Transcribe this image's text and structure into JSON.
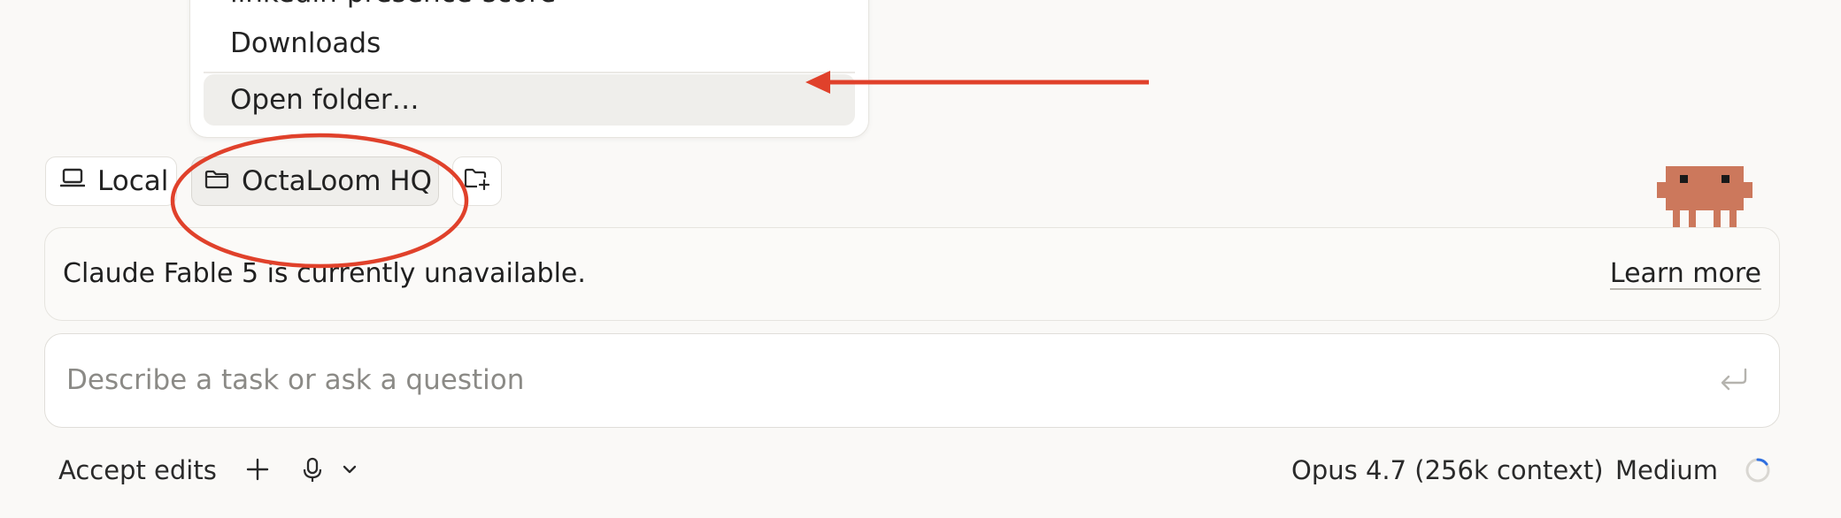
{
  "menu": {
    "cut_item_label": "linkedin-presence-score",
    "items": [
      {
        "label": "Downloads"
      },
      {
        "label": "Open folder…"
      }
    ]
  },
  "chips": {
    "local_label": "Local",
    "folder_label": "OctaLoom HQ",
    "add_folder_icon": "folder-plus-icon"
  },
  "notice": {
    "text": "Claude Fable 5 is currently unavailable.",
    "link": "Learn more"
  },
  "input": {
    "placeholder": "Describe a task or ask a question"
  },
  "toolbar": {
    "accept_edits": "Accept edits",
    "model": "Opus 4.7 (256k context)",
    "effort": "Medium"
  },
  "colors": {
    "annotation": "#e0412b",
    "mascot": "#cc785c",
    "background": "#faf9f7",
    "spinner_accent": "#2f6fe0"
  }
}
